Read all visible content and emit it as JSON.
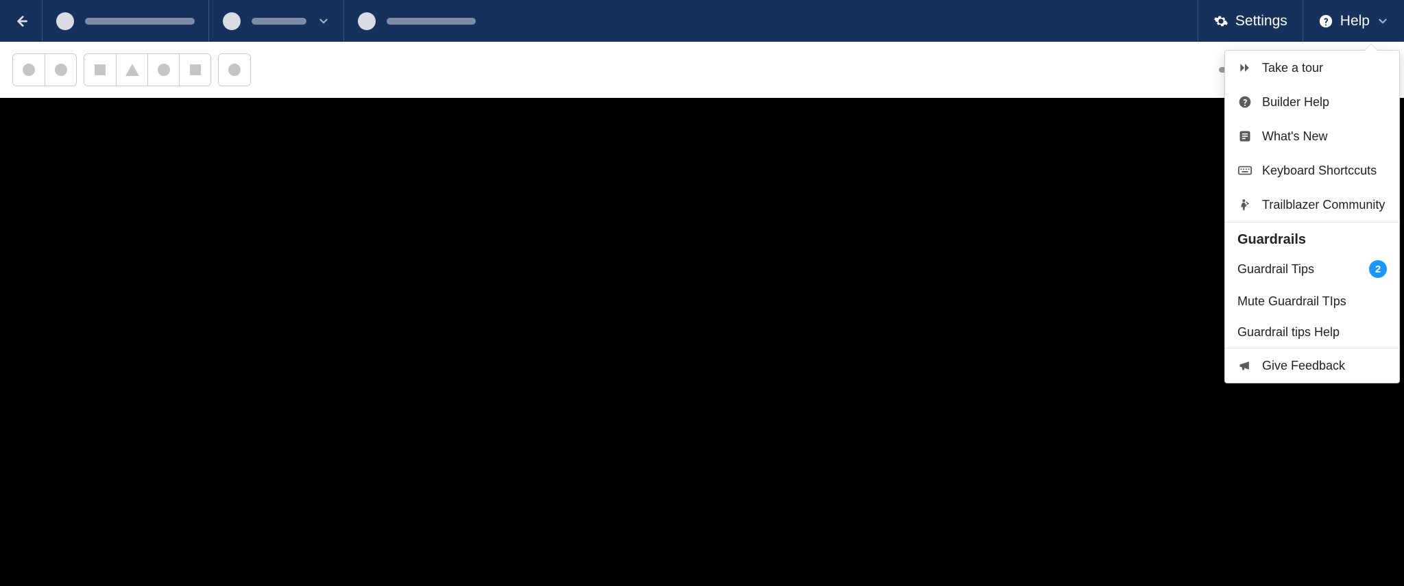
{
  "header": {
    "settings_label": "Settings",
    "help_label": "Help"
  },
  "help_menu": {
    "items": [
      {
        "icon": "double-chevron-icon",
        "label": "Take a tour"
      },
      {
        "icon": "question-icon",
        "label": "Builder Help"
      },
      {
        "icon": "whats-new-icon",
        "label": "What's New"
      },
      {
        "icon": "keyboard-icon",
        "label": "Keyboard Shortccuts"
      },
      {
        "icon": "trailblazer-icon",
        "label": "Trailblazer Community"
      }
    ],
    "guardrails": {
      "heading": "Guardrails",
      "items": [
        {
          "label": "Guardrail Tips",
          "badge": "2"
        },
        {
          "label": "Mute Guardrail TIps"
        },
        {
          "label": "Guardrail tips Help"
        }
      ]
    },
    "feedback": {
      "icon": "megaphone-icon",
      "label": "Give Feedback"
    }
  }
}
